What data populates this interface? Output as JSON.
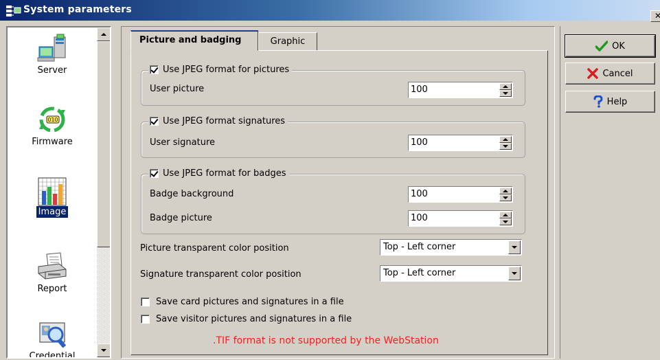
{
  "window": {
    "title": "System parameters",
    "close_glyph": "✕"
  },
  "sidebar": {
    "items": [
      {
        "label": "Server",
        "icon": "server-icon",
        "selected": false
      },
      {
        "label": "Firmware",
        "icon": "firmware-icon",
        "selected": false
      },
      {
        "label": "Image",
        "icon": "image-icon",
        "selected": true
      },
      {
        "label": "Report",
        "icon": "printer-icon",
        "selected": false
      },
      {
        "label": "Credential",
        "icon": "credential-icon",
        "selected": false
      }
    ]
  },
  "tabs": [
    {
      "label": "Picture and badging",
      "active": true
    },
    {
      "label": "Graphic",
      "active": false
    }
  ],
  "groups": {
    "pictures": {
      "checkbox_label": "Use JPEG format for pictures",
      "checked": true,
      "fields": [
        {
          "label": "User picture",
          "value": "100"
        }
      ]
    },
    "signatures": {
      "checkbox_label": "Use JPEG format signatures",
      "checked": true,
      "fields": [
        {
          "label": "User signature",
          "value": "100"
        }
      ]
    },
    "badges": {
      "checkbox_label": "Use JPEG format for badges",
      "checked": true,
      "fields": [
        {
          "label": "Badge background",
          "value": "100"
        },
        {
          "label": "Badge picture",
          "value": "100"
        }
      ]
    }
  },
  "dropdowns": [
    {
      "label": "Picture transparent color position",
      "value": "Top - Left corner"
    },
    {
      "label": "Signature transparent color position",
      "value": "Top - Left corner"
    }
  ],
  "checkboxes": [
    {
      "label": "Save card pictures and signatures in a file",
      "checked": false
    },
    {
      "label": "Save visitor pictures and signatures in a file",
      "checked": false
    }
  ],
  "note": {
    "text": ".TIF format is not supported by the WebStation",
    "color": "#ff1a1a"
  },
  "buttons": {
    "ok": {
      "label": "OK",
      "icon": "checkmark-icon"
    },
    "cancel": {
      "label": "Cancel",
      "icon": "x-icon"
    },
    "help": {
      "label": "Help",
      "icon": "question-icon"
    }
  }
}
